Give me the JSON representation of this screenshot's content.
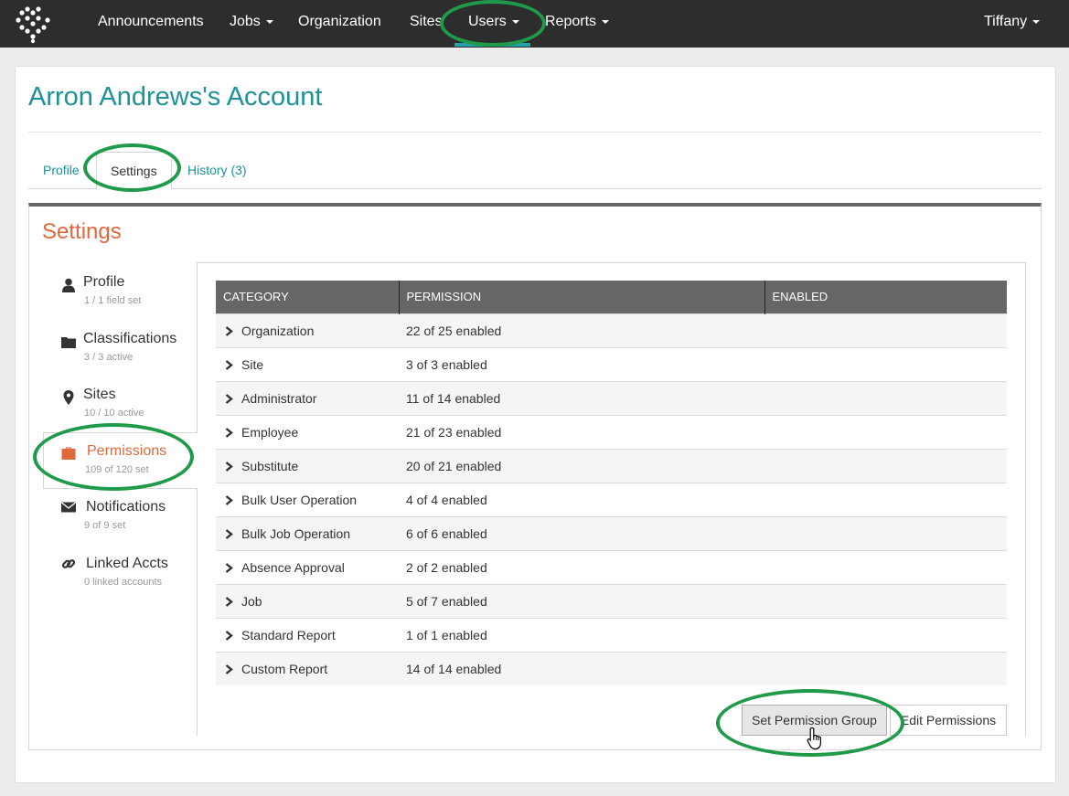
{
  "nav": {
    "items": [
      {
        "label": "Announcements",
        "caret": false
      },
      {
        "label": "Jobs",
        "caret": true
      },
      {
        "label": "Organization",
        "caret": false
      },
      {
        "label": "Sites",
        "caret": false
      },
      {
        "label": "Users",
        "caret": true,
        "active": true
      },
      {
        "label": "Reports",
        "caret": true
      }
    ],
    "user": "Tiffany",
    "accent_color": "#23a3a8"
  },
  "page": {
    "title": "Arron Andrews's Account"
  },
  "tabs": [
    {
      "label": "Profile",
      "active": false
    },
    {
      "label": "Settings",
      "active": true
    },
    {
      "label": "History (3)",
      "active": false
    }
  ],
  "settings": {
    "heading": "Settings",
    "menu": [
      {
        "icon": "user-icon",
        "label": "Profile",
        "sub": "1 / 1 field set"
      },
      {
        "icon": "folder-icon",
        "label": "Classifications",
        "sub": "3 / 3 active"
      },
      {
        "icon": "map-marker-icon",
        "label": "Sites",
        "sub": "10 / 10 active"
      },
      {
        "icon": "briefcase-icon",
        "label": "Permissions",
        "sub": "109 of 120 set",
        "active": true
      },
      {
        "icon": "envelope-icon",
        "label": "Notifications",
        "sub": "9 of 9 set"
      },
      {
        "icon": "link-icon",
        "label": "Linked Accts",
        "sub": "0 linked accounts"
      }
    ]
  },
  "table": {
    "headers": [
      "CATEGORY",
      "PERMISSION",
      "ENABLED"
    ],
    "rows": [
      {
        "category": "Organization",
        "permission": "22 of 25 enabled"
      },
      {
        "category": "Site",
        "permission": "3 of 3 enabled"
      },
      {
        "category": "Administrator",
        "permission": "11 of 14 enabled"
      },
      {
        "category": "Employee",
        "permission": "21 of 23 enabled"
      },
      {
        "category": "Substitute",
        "permission": "20 of 21 enabled"
      },
      {
        "category": "Bulk User Operation",
        "permission": "4 of 4 enabled"
      },
      {
        "category": "Bulk Job Operation",
        "permission": "6 of 6 enabled"
      },
      {
        "category": "Absence Approval",
        "permission": "2 of 2 enabled"
      },
      {
        "category": "Job",
        "permission": "5 of 7 enabled"
      },
      {
        "category": "Standard Report",
        "permission": "1 of 1 enabled"
      },
      {
        "category": "Custom Report",
        "permission": "14 of 14 enabled"
      }
    ]
  },
  "buttons": {
    "set_group": "Set Permission Group",
    "edit": "Edit Permissions"
  },
  "colors": {
    "title": "#1d9298",
    "settings_heading": "#e0693b",
    "annotation": "#1f9a49"
  }
}
